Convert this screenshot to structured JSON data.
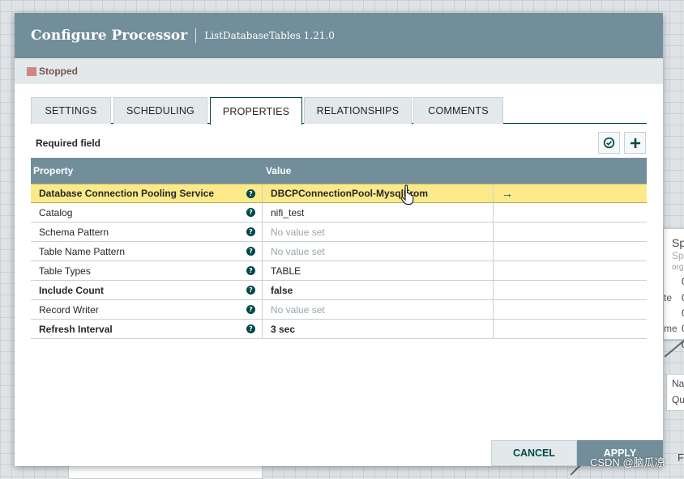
{
  "background": {
    "node_title": "Sp",
    "node_subtitle": "Sp",
    "node_org": "org",
    "row_labels": [
      "te",
      "me"
    ],
    "row_values": [
      "0",
      "0",
      "0",
      "0",
      "0"
    ],
    "queue_labels": [
      "Na",
      "Qu"
    ],
    "bottom_fragment": "F"
  },
  "dialog": {
    "title": "Configure Processor",
    "subtitle": "ListDatabaseTables 1.21.0",
    "status": "Stopped"
  },
  "tabs": [
    {
      "label": "SETTINGS",
      "active": false
    },
    {
      "label": "SCHEDULING",
      "active": false
    },
    {
      "label": "PROPERTIES",
      "active": true
    },
    {
      "label": "RELATIONSHIPS",
      "active": false
    },
    {
      "label": "COMMENTS",
      "active": false
    }
  ],
  "properties": {
    "required_label": "Required field",
    "verify_icon": "check-circle-icon",
    "add_icon": "plus-icon",
    "columns": [
      "Property",
      "Value"
    ],
    "rows": [
      {
        "name": "Database Connection Pooling Service",
        "value": "DBCPConnectionPool-MysqlFrom",
        "required": true,
        "selected": true,
        "empty": false,
        "action": "→"
      },
      {
        "name": "Catalog",
        "value": "nifi_test",
        "required": false,
        "selected": false,
        "empty": false,
        "action": ""
      },
      {
        "name": "Schema Pattern",
        "value": "No value set",
        "required": false,
        "selected": false,
        "empty": true,
        "action": ""
      },
      {
        "name": "Table Name Pattern",
        "value": "No value set",
        "required": false,
        "selected": false,
        "empty": true,
        "action": ""
      },
      {
        "name": "Table Types",
        "value": "TABLE",
        "required": false,
        "selected": false,
        "empty": false,
        "action": ""
      },
      {
        "name": "Include Count",
        "value": "false",
        "required": true,
        "selected": false,
        "empty": false,
        "action": ""
      },
      {
        "name": "Record Writer",
        "value": "No value set",
        "required": false,
        "selected": false,
        "empty": true,
        "action": ""
      },
      {
        "name": "Refresh Interval",
        "value": "3 sec",
        "required": true,
        "selected": false,
        "empty": false,
        "action": ""
      }
    ],
    "help_glyph": "?"
  },
  "footer": {
    "cancel_label": "CANCEL",
    "apply_label": "APPLY"
  },
  "watermark": "CSDN @脑瓜凉",
  "colors": {
    "header": "#728e9b",
    "accent": "#004849",
    "selected_row": "#fcea8a",
    "stopped": "#d18686"
  }
}
